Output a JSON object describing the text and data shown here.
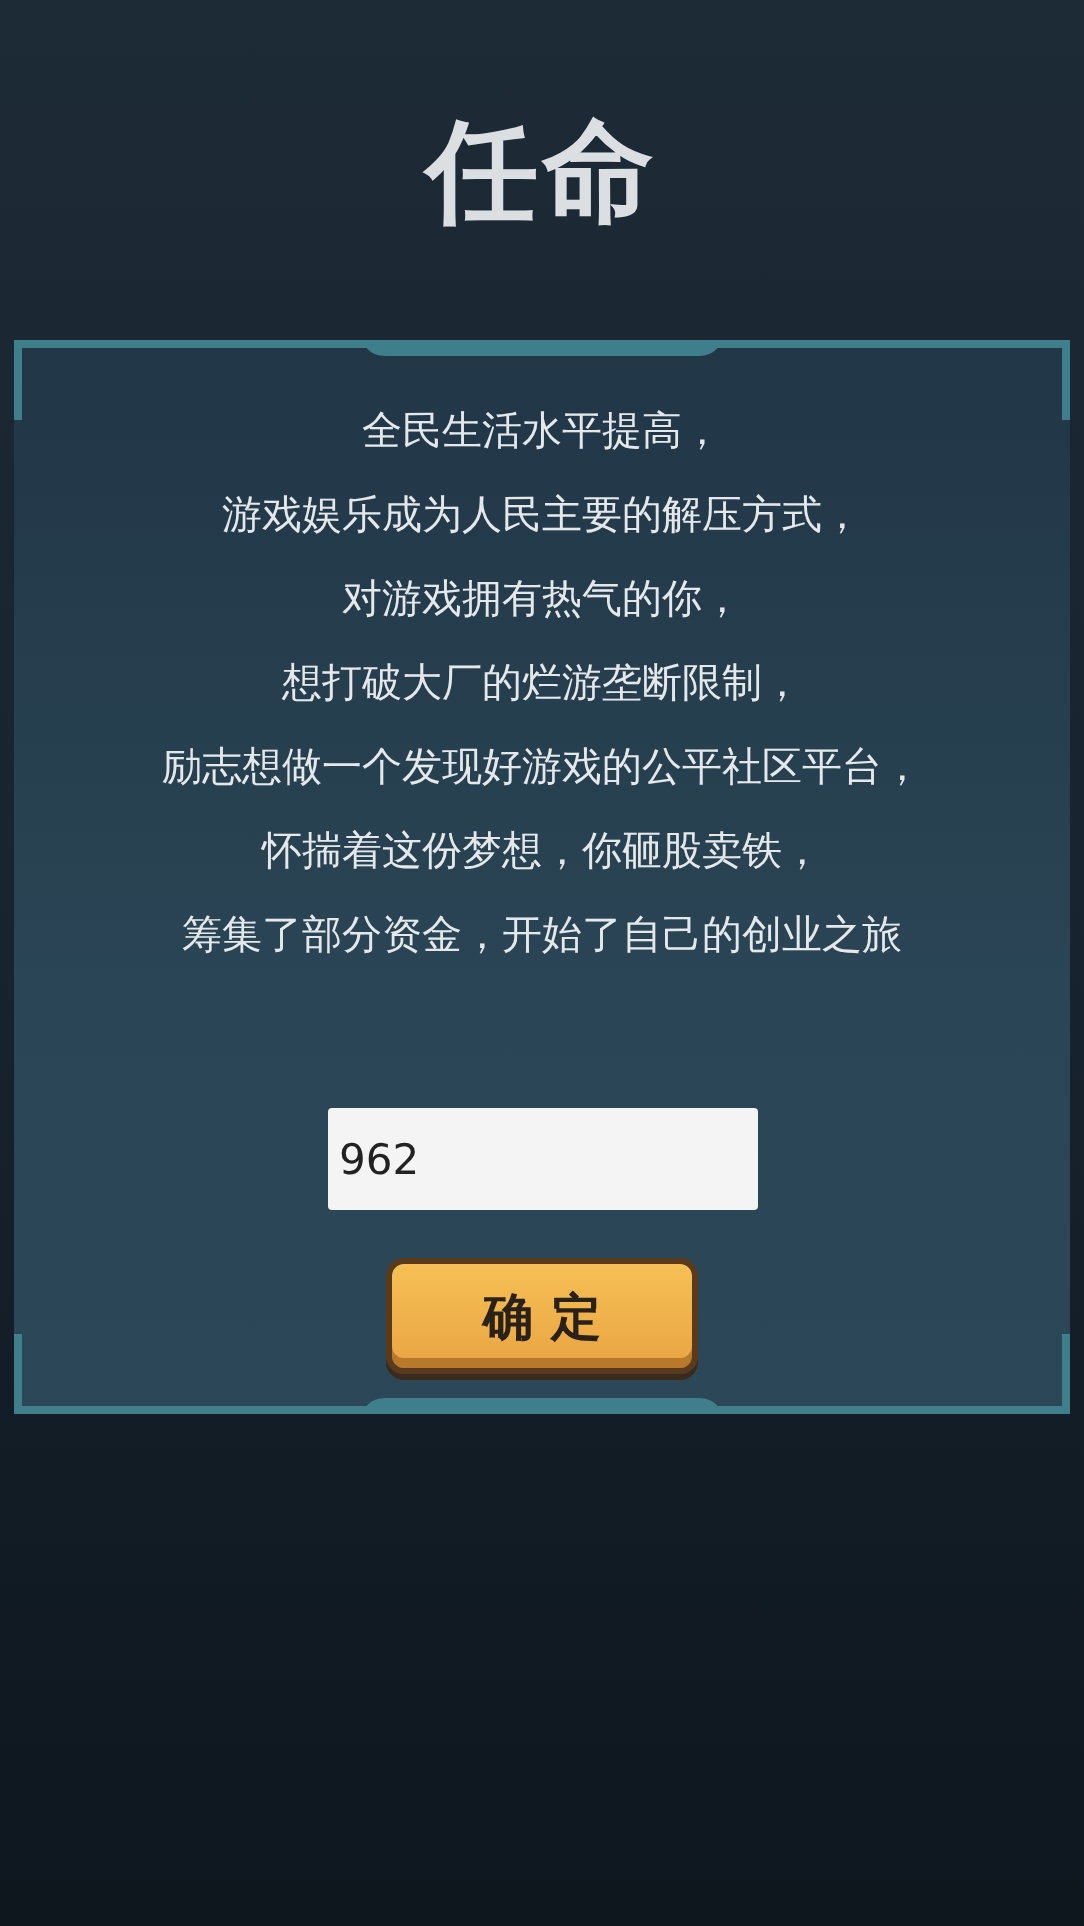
{
  "title": "任命",
  "story_lines": [
    "全民生活水平提高，",
    "游戏娱乐成为人民主要的解压方式，",
    "对游戏拥有热气的你，",
    "想打破大厂的烂游垄断限制，",
    "励志想做一个发现好游戏的公平社区平台，",
    "怀揣着这份梦想，你砸股卖铁，",
    "筹集了部分资金，开始了自己的创业之旅"
  ],
  "name_field": {
    "value": "962"
  },
  "confirm_button": {
    "label": "确 定"
  }
}
